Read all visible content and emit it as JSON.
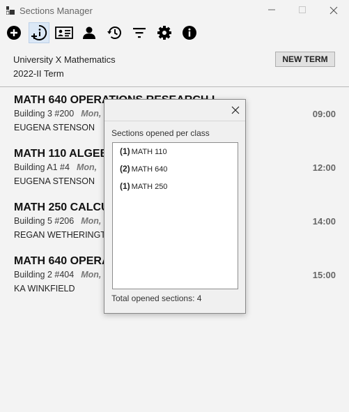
{
  "window": {
    "title": "Sections Manager"
  },
  "toolbar": {
    "buttons": [
      {
        "icon": "add-icon"
      },
      {
        "icon": "info-add-icon"
      },
      {
        "icon": "id-card-icon"
      },
      {
        "icon": "person-icon"
      },
      {
        "icon": "history-icon"
      },
      {
        "icon": "filter-icon"
      },
      {
        "icon": "gear-icon"
      },
      {
        "icon": "info-icon"
      }
    ]
  },
  "header": {
    "university": "University X Mathematics",
    "term": "2022-II Term",
    "new_term_label": "NEW TERM"
  },
  "sections": [
    {
      "title": "MATH 640 OPERATIONS RESEARCH I",
      "location": "Building 3 #200",
      "days": "Mon,",
      "teacher": "EUGENA STENSON",
      "time": "09:00"
    },
    {
      "title": "MATH 110 ALGEBRA",
      "location": "Building A1 #4",
      "days": "Mon,",
      "teacher": "EUGENA STENSON",
      "time": "12:00"
    },
    {
      "title": "MATH 250 CALCULUS",
      "location": "Building 5 #206",
      "days": "Mon,",
      "teacher": "REGAN WETHERINGTON",
      "time": "14:00"
    },
    {
      "title": "MATH 640 OPERATIONS RESEARCH I",
      "location": "Building 2 #404",
      "days": "Mon,",
      "teacher": "KA WINKFIELD",
      "time": "15:00"
    }
  ],
  "dialog": {
    "label": "Sections opened per class",
    "items": [
      {
        "count": "(1)",
        "name": "MATH 110"
      },
      {
        "count": "(2)",
        "name": "MATH 640"
      },
      {
        "count": "(1)",
        "name": "MATH 250"
      }
    ],
    "total": "Total opened sections: 4"
  }
}
